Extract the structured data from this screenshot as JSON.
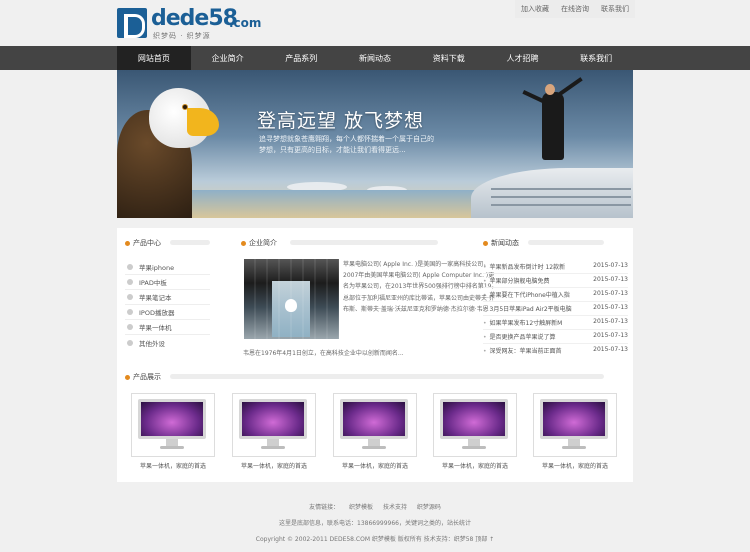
{
  "header": {
    "logo_text": "dede58",
    "logo_suffix": ".com",
    "logo_sub": "织梦码 · 织梦源",
    "top_links": [
      "加入收藏",
      "在线咨询",
      "联系我们"
    ]
  },
  "nav": {
    "items": [
      "网站首页",
      "企业简介",
      "产品系列",
      "新闻动态",
      "资料下载",
      "人才招聘",
      "联系我们"
    ],
    "active_index": 0
  },
  "banner": {
    "slogan": "登高远望 放飞梦想",
    "sub": "追寻梦想就象苍鹰翱翔，每个人都怀揣着一个属于自己的梦想，只有更高的目标，才能让我们看得更远..."
  },
  "products_menu": {
    "title": "产品中心",
    "items": [
      "苹果iphone",
      "IPAD中板",
      "苹果笔记本",
      "IPOD播放器",
      "苹果一体机",
      "其他外设"
    ]
  },
  "intro": {
    "title": "企业简介",
    "text": "苹果电脑公司( Apple Inc. )是美国的一家高科技公司，2007年由美国苹果电脑公司( Apple Computer Inc. )更名为苹果公司，在2013年世界500强排行榜中排名第19。总部位于加利福尼亚州的库比蒂诺，苹果公司由史蒂夫·乔布斯、斯蒂夫·盖瑞·沃兹尼亚克和罗纳德·杰拉尔德·韦恩",
    "text_last": "韦恩在1976年4月1日创立，在高科技企业中以创新而闻名..."
  },
  "news": {
    "title": "新闻动态",
    "items": [
      {
        "title": "苹果新品发布倒计时 12款新",
        "date": "2015-07-13"
      },
      {
        "title": "苹果部分旗舰电脑免费",
        "date": "2015-07-13"
      },
      {
        "title": "苹果要在下代iPhone中植入指",
        "date": "2015-07-13"
      },
      {
        "title": "3月5日苹果iPad Air2平板电脑",
        "date": "2015-07-13"
      },
      {
        "title": "如果苹果发布12寸触屏新M",
        "date": "2015-07-13"
      },
      {
        "title": "是否更换产品苹果说了算",
        "date": "2015-07-13"
      },
      {
        "title": "深受网友：苹果当前正面首",
        "date": "2015-07-13"
      }
    ]
  },
  "showcase": {
    "title": "产品展示",
    "items": [
      "苹果一体机，家庭的首选",
      "苹果一体机，家庭的首选",
      "苹果一体机，家庭的首选",
      "苹果一体机，家庭的首选",
      "苹果一体机，家庭的首选"
    ]
  },
  "footer": {
    "links_label": "友情链接：",
    "links": [
      "织梦模板",
      "技术支持",
      "织梦源码"
    ],
    "contact": "这里是底部信息，联系电话：13866999966，关键词之类的，站长统计",
    "copyright": "Copyright © 2002-2011 DEDE58.COM 织梦模板 版权所有  技术支持：织梦58  顶部 ↑"
  },
  "colors": {
    "nav_bg": "#444444",
    "nav_active": "#222222",
    "accent": "#e38a1e",
    "logo_blue": "#1b5f96"
  }
}
